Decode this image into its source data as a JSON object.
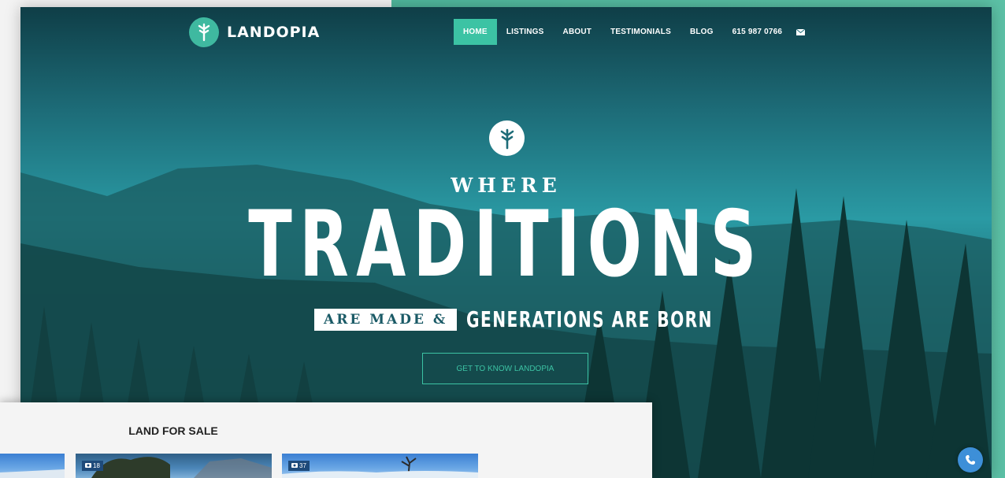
{
  "brand": {
    "name": "LANDOPIA"
  },
  "nav": {
    "items": [
      {
        "label": "HOME",
        "active": true
      },
      {
        "label": "LISTINGS",
        "active": false
      },
      {
        "label": "ABOUT",
        "active": false
      },
      {
        "label": "TESTIMONIALS",
        "active": false
      },
      {
        "label": "BLOG",
        "active": false
      },
      {
        "label": "615 987 0766",
        "active": false
      }
    ],
    "mail_icon": "envelope-icon"
  },
  "hero": {
    "line1": "WHERE",
    "line2": "TRADITIONS",
    "line3_boxed": "ARE MADE &",
    "line3_rest": "GENERATIONS ARE BORN",
    "cta_label": "GET TO KNOW LANDOPIA",
    "badge_icon": "tree-icon"
  },
  "section": {
    "title": "LAND FOR SALE",
    "listings": [
      {
        "photo_count": "",
        "icon": "camera-icon"
      },
      {
        "photo_count": "18",
        "icon": "camera-icon"
      },
      {
        "photo_count": "37",
        "icon": "camera-icon"
      }
    ]
  },
  "colors": {
    "accent": "#3cc3a4",
    "hero_dark": "#0f3e47",
    "hero_mid": "#2a9aa4",
    "phone_button": "#3d8fd8"
  },
  "floating": {
    "phone_icon": "phone-icon"
  }
}
